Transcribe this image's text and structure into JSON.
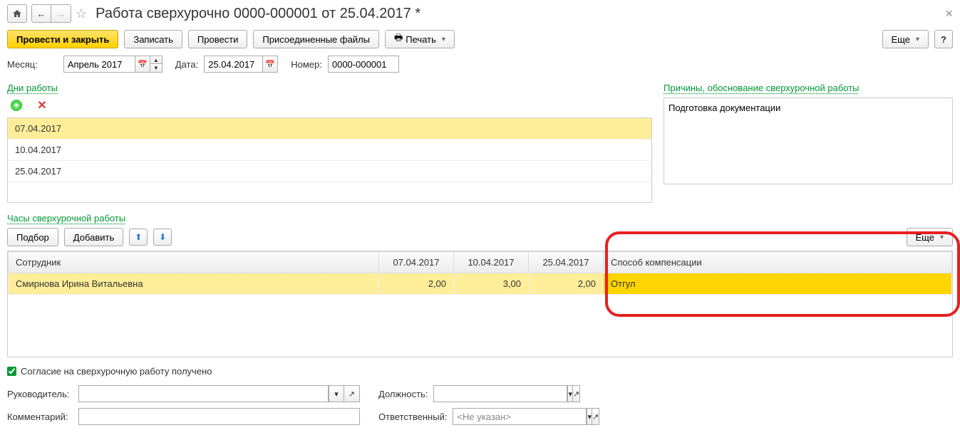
{
  "header": {
    "title": "Работа сверхурочно 0000-000001 от 25.04.2017 *"
  },
  "actions": {
    "post_close": "Провести и закрыть",
    "save": "Записать",
    "post": "Провести",
    "attach": "Присоединенные файлы",
    "print": "Печать",
    "more": "Еще"
  },
  "fields": {
    "month_label": "Месяц:",
    "month_value": "Апрель 2017",
    "date_label": "Дата:",
    "date_value": "25.04.2017",
    "number_label": "Номер:",
    "number_value": "0000-000001"
  },
  "days_section": {
    "title": "Дни работы",
    "items": [
      "07.04.2017",
      "10.04.2017",
      "25.04.2017"
    ],
    "selected": 0
  },
  "reason_section": {
    "title": "Причины, обоснование сверхурочной работы",
    "text": "Подготовка документации"
  },
  "hours_section": {
    "title": "Часы сверхурочной работы",
    "pick": "Подбор",
    "add": "Добавить",
    "more": "Еще",
    "columns": {
      "employee": "Сотрудник",
      "d1": "07.04.2017",
      "d2": "10.04.2017",
      "d3": "25.04.2017",
      "comp": "Способ компенсации"
    },
    "row": {
      "employee": "Смирнова Ирина Витальевна",
      "v1": "2,00",
      "v2": "3,00",
      "v3": "2,00",
      "comp": "Отгул"
    }
  },
  "consent": {
    "label": "Согласие на сверхурочную работу получено",
    "checked": true
  },
  "footer": {
    "manager_label": "Руководитель:",
    "manager_value": "",
    "position_label": "Должность:",
    "position_value": "",
    "comment_label": "Комментарий:",
    "comment_value": "",
    "responsible_label": "Ответственный:",
    "responsible_value": "<Не указан>"
  }
}
